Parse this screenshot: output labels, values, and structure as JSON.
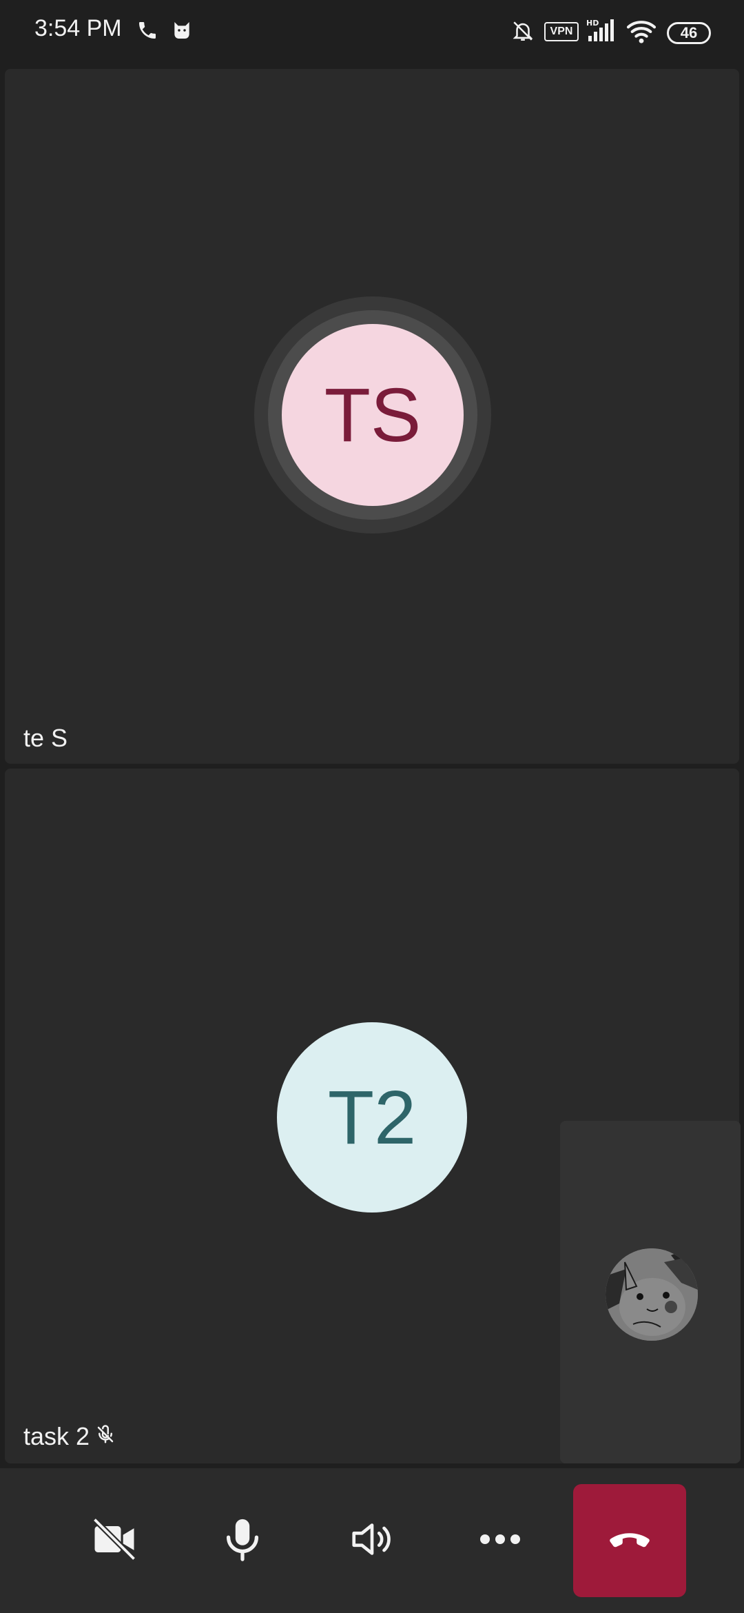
{
  "status_bar": {
    "time": "3:54 PM",
    "icons": [
      "phone-icon",
      "cat-icon",
      "bell-off-icon",
      "vpn-icon",
      "hd-signal-icon",
      "wifi-icon",
      "battery-icon"
    ],
    "vpn_label": "VPN",
    "battery_level": "46"
  },
  "participants": [
    {
      "initials": "TS",
      "name": "te S",
      "speaking": true,
      "avatar_bg": "#f5d6e0",
      "avatar_fg": "#7a1c3a"
    },
    {
      "initials": "T2",
      "name": "task 2",
      "muted": true,
      "avatar_bg": "#dceff1",
      "avatar_fg": "#2e6569"
    }
  ],
  "self_view": {
    "avatar_icon": "pikachu-avatar"
  },
  "controls": [
    {
      "name": "camera-off-button",
      "icon": "video-off-icon"
    },
    {
      "name": "microphone-button",
      "icon": "microphone-icon"
    },
    {
      "name": "speaker-button",
      "icon": "speaker-icon"
    },
    {
      "name": "more-options-button",
      "icon": "more-horizontal-icon"
    },
    {
      "name": "end-call-button",
      "icon": "hang-up-icon",
      "color": "#9e1a3a"
    }
  ]
}
